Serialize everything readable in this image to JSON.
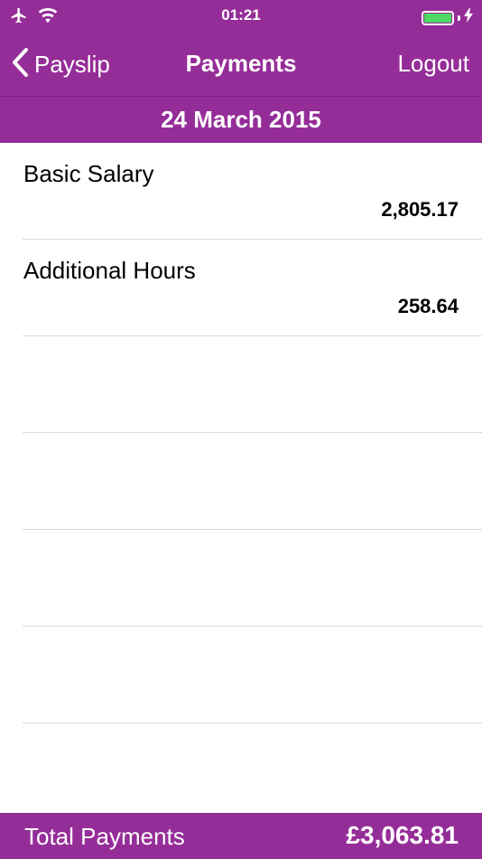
{
  "status_bar": {
    "time": "01:21",
    "icons": [
      "airplane-icon",
      "wifi-icon",
      "battery-icon",
      "charging-bolt-icon"
    ]
  },
  "navbar": {
    "back_label": "Payslip",
    "title": "Payments",
    "logout_label": "Logout"
  },
  "date": "24 March 2015",
  "payments": [
    {
      "label": "Basic Salary",
      "amount": "2,805.17"
    },
    {
      "label": "Additional Hours",
      "amount": "258.64"
    }
  ],
  "empty_rows": 5,
  "footer": {
    "label": "Total Payments",
    "total": "£3,063.81"
  },
  "colors": {
    "brand": "#952d98",
    "battery": "#4cd964",
    "separator": "#d9d9d9"
  }
}
